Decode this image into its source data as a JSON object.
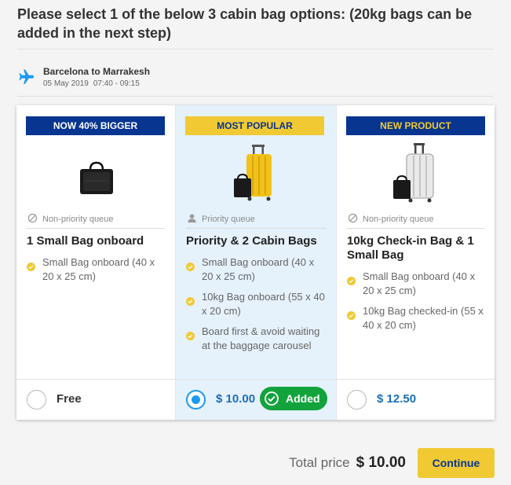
{
  "page": {
    "title": "Please select 1 of the below 3 cabin bag options: (20kg bags can be added in the next step)"
  },
  "flight": {
    "route": "Barcelona to Marrakesh",
    "date": "05 May 2019",
    "time": "07:40 - 09:15",
    "icon": "airplane-icon"
  },
  "options": [
    {
      "badge": "NOW 40% BIGGER",
      "queue": "Non-priority queue",
      "title": "1 Small Bag onboard",
      "features": [
        "Small Bag onboard (40 x 20 x 25 cm)"
      ],
      "price": "Free",
      "selected": false
    },
    {
      "badge": "MOST POPULAR",
      "queue": "Priority queue",
      "title": "Priority & 2 Cabin Bags",
      "features": [
        "Small Bag onboard (40 x 20 x 25 cm)",
        "10kg Bag onboard (55 x 40 x 20 cm)",
        "Board first & avoid waiting at the baggage carousel"
      ],
      "price": "$ 10.00",
      "selected": true,
      "added_label": "Added"
    },
    {
      "badge": "NEW PRODUCT",
      "queue": "Non-priority queue",
      "title": "10kg Check-in Bag & 1 Small Bag",
      "features": [
        "Small Bag onboard (40 x 20 x 25 cm)",
        "10kg Bag checked-in (55 x 40 x 20 cm)"
      ],
      "price": "$ 12.50",
      "selected": false
    }
  ],
  "footer": {
    "total_label": "Total price",
    "total_value": "$ 10.00",
    "continue_label": "Continue"
  },
  "colors": {
    "brand_navy": "#073590",
    "brand_yellow": "#f1c933",
    "selected_blue": "#1b9bf0",
    "added_green": "#12a33d",
    "highlight_bg": "#e5f1fb"
  }
}
